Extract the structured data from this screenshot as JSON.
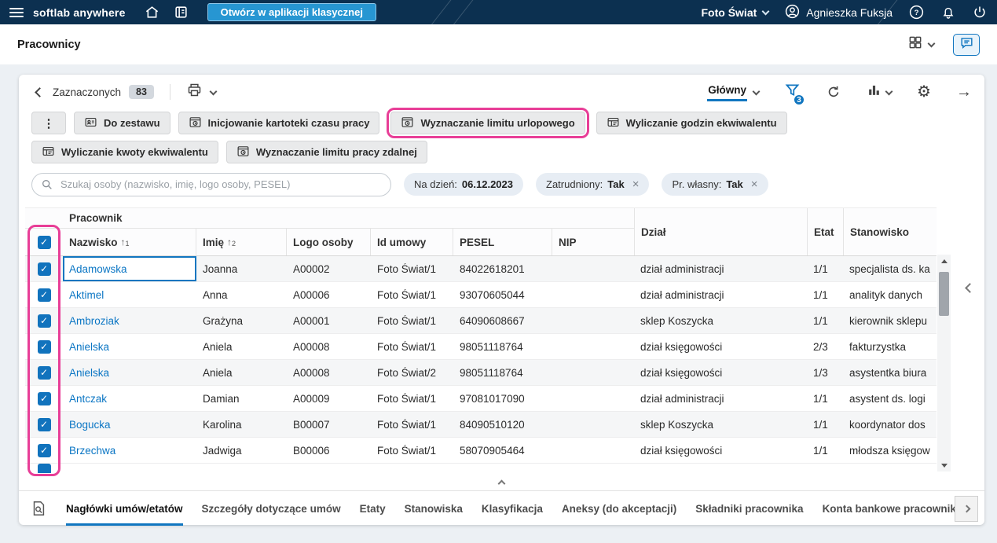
{
  "icons": {
    "more": "⋮",
    "gear": "⚙",
    "arrow_right": "→",
    "check": "✓",
    "close": "×",
    "sort_arrow": "↑",
    "question": "?"
  },
  "topbar": {
    "brand": "softlab anywhere",
    "open_classic_label": "Otwórz w aplikacji klasycznej",
    "company": "Foto Świat",
    "user": "Agnieszka Fuksja"
  },
  "page": {
    "title": "Pracownicy"
  },
  "toolbar": {
    "selected_label": "Zaznaczonych",
    "selected_count": "83",
    "view_name": "Główny",
    "filter_badge": "3"
  },
  "actions": {
    "do_zestawu": "Do zestawu",
    "inicjowanie_kartoteki": "Inicjowanie kartoteki czasu pracy",
    "wyznaczanie_limitu_urlopowego": "Wyznaczanie limitu urlopowego",
    "wyliczanie_godzin": "Wyliczanie godzin ekwiwalentu",
    "wyliczanie_kwoty": "Wyliczanie kwoty ekwiwalentu",
    "wyznaczanie_limitu_pracy_zdalnej": "Wyznaczanie limitu pracy zdalnej"
  },
  "filters": {
    "search_placeholder": "Szukaj osoby (nazwisko, imię, logo osoby, PESEL)",
    "date_label": "Na dzień:",
    "date_value": "06.12.2023",
    "employed_label": "Zatrudniony:",
    "employed_value": "Tak",
    "own_label": "Pr. własny:",
    "own_value": "Tak"
  },
  "table": {
    "group_pracownik": "Pracownik",
    "columns": {
      "nazwisko": "Nazwisko",
      "imie": "Imię",
      "logo": "Logo osoby",
      "umowa": "Id umowy",
      "pesel": "PESEL",
      "nip": "NIP",
      "dzial": "Dział",
      "etat": "Etat",
      "stanowisko": "Stanowisko"
    },
    "sort": {
      "nazwisko": "1",
      "imie": "2"
    },
    "rows": [
      {
        "nazwisko": "Adamowska",
        "imie": "Joanna",
        "logo": "A00002",
        "umowa": "Foto Świat/1",
        "pesel": "84022618201",
        "nip": "",
        "dzial": "dział administracji",
        "etat": "1/1",
        "stanowisko": "specjalista ds. ka"
      },
      {
        "nazwisko": "Aktimel",
        "imie": "Anna",
        "logo": "A00006",
        "umowa": "Foto Świat/1",
        "pesel": "93070605044",
        "nip": "",
        "dzial": "dział administracji",
        "etat": "1/1",
        "stanowisko": "analityk danych"
      },
      {
        "nazwisko": "Ambroziak",
        "imie": "Grażyna",
        "logo": "A00001",
        "umowa": "Foto Świat/1",
        "pesel": "64090608667",
        "nip": "",
        "dzial": "sklep Koszycka",
        "etat": "1/1",
        "stanowisko": "kierownik sklepu"
      },
      {
        "nazwisko": "Anielska",
        "imie": "Aniela",
        "logo": "A00008",
        "umowa": "Foto Świat/1",
        "pesel": "98051118764",
        "nip": "",
        "dzial": "dział księgowości",
        "etat": "2/3",
        "stanowisko": "fakturzystka"
      },
      {
        "nazwisko": "Anielska",
        "imie": "Aniela",
        "logo": "A00008",
        "umowa": "Foto Świat/2",
        "pesel": "98051118764",
        "nip": "",
        "dzial": "dział księgowości",
        "etat": "1/3",
        "stanowisko": "asystentka biura"
      },
      {
        "nazwisko": "Antczak",
        "imie": "Damian",
        "logo": "A00009",
        "umowa": "Foto Świat/1",
        "pesel": "97081017090",
        "nip": "",
        "dzial": "dział administracji",
        "etat": "1/1",
        "stanowisko": "asystent ds. logi"
      },
      {
        "nazwisko": "Bogucka",
        "imie": "Karolina",
        "logo": "B00007",
        "umowa": "Foto Świat/1",
        "pesel": "84090510120",
        "nip": "",
        "dzial": "sklep Koszycka",
        "etat": "1/1",
        "stanowisko": "koordynator dos"
      },
      {
        "nazwisko": "Brzechwa",
        "imie": "Jadwiga",
        "logo": "B00006",
        "umowa": "Foto Świat/1",
        "pesel": "58070905464",
        "nip": "",
        "dzial": "dział księgowości",
        "etat": "1/1",
        "stanowisko": "młodsza księgow"
      }
    ]
  },
  "tabs": {
    "items": [
      "Nagłówki umów/etatów",
      "Szczegóły dotyczące umów",
      "Etaty",
      "Stanowiska",
      "Klasyfikacja",
      "Aneksy (do akceptacji)",
      "Składniki pracownika",
      "Konta bankowe pracownik"
    ]
  },
  "colors": {
    "topbar_navy": "#0c3050",
    "accent": "#1176c0",
    "highlight_pink": "#e83e97",
    "link_blue": "#0b76c4"
  }
}
